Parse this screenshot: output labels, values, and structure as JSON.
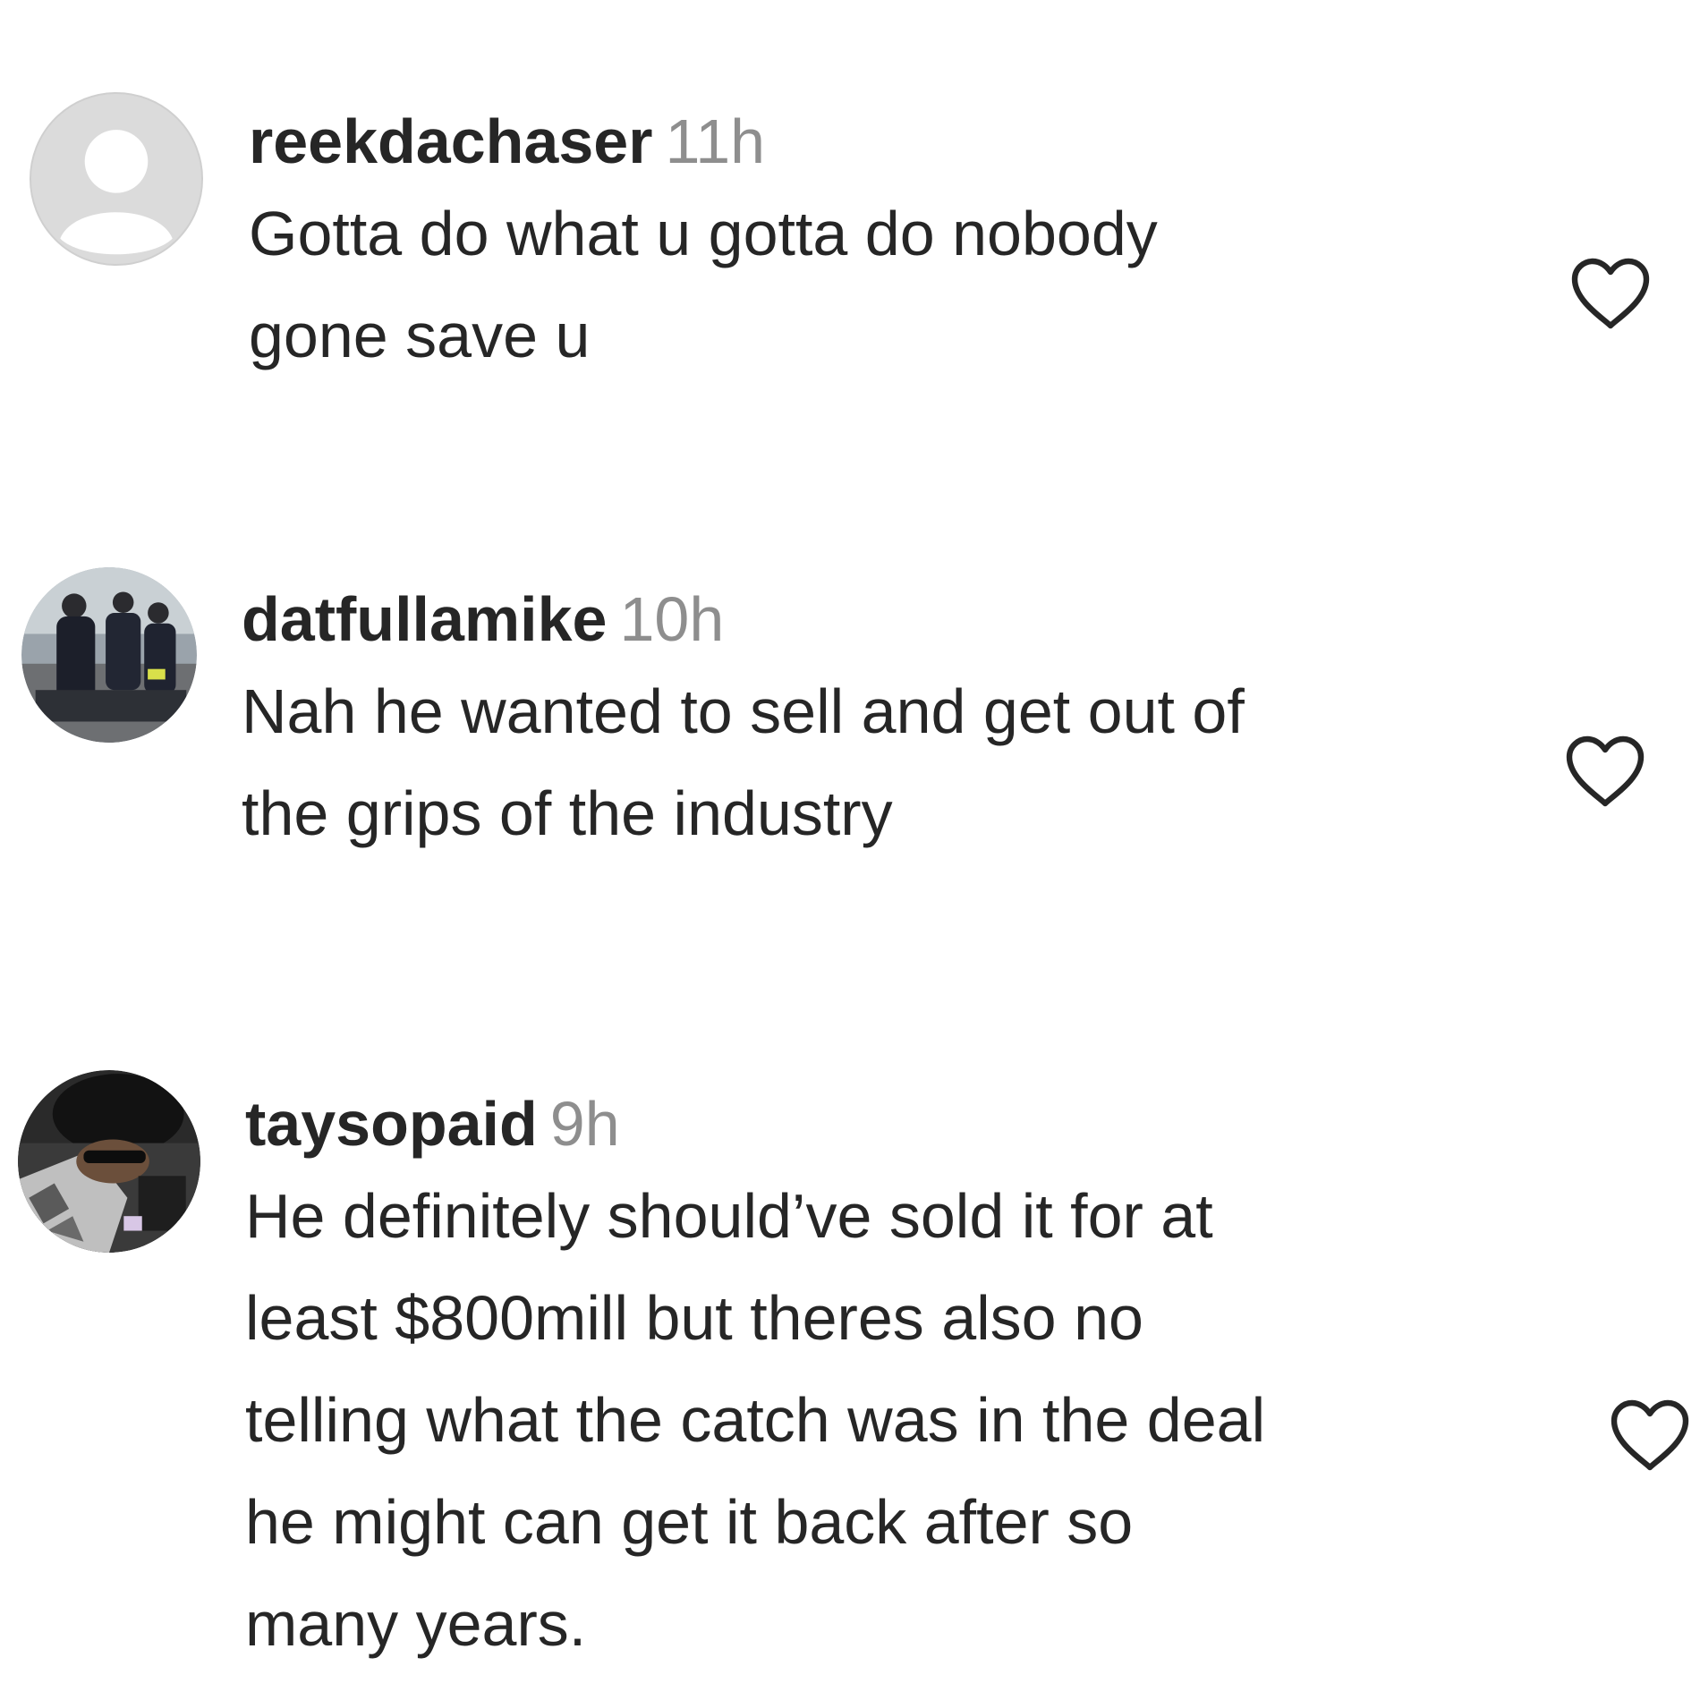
{
  "comments": [
    {
      "username": "reekdachaser",
      "timestamp": "11h",
      "text_lines": [
        "Gotta do what u gotta do nobody",
        "gone save u"
      ],
      "avatar": "default-avatar-icon",
      "like_icon": "heart-outline-icon"
    },
    {
      "username": "datfullamike",
      "timestamp": "10h",
      "text_lines": [
        "Nah he wanted to sell and get out of",
        "the grips of the industry"
      ],
      "avatar": "profile-photo",
      "like_icon": "heart-outline-icon"
    },
    {
      "username": "taysopaid",
      "timestamp": "9h",
      "text_lines": [
        "He definitely should’ve sold it for at",
        "least $800mill but theres also no",
        "telling what the catch was in the deal",
        "he might can get it back after so",
        "many years."
      ],
      "avatar": "profile-photo",
      "like_icon": "heart-outline-icon"
    }
  ],
  "colors": {
    "text": "#262626",
    "muted": "#8e8e8e",
    "icon_stroke": "#262626",
    "default_avatar_bg": "#dbdbdb"
  }
}
